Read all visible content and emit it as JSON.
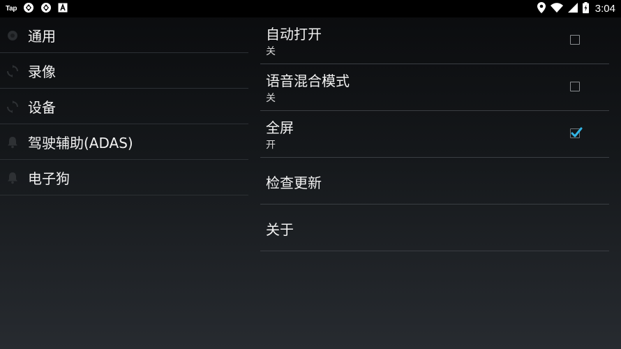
{
  "status_bar": {
    "left_icons": [
      "tap-label",
      "aperture-icon",
      "aperture-icon",
      "a-box-icon"
    ],
    "tap_text": "Tap",
    "right_icons": [
      "location-icon",
      "wifi-icon",
      "signal-icon",
      "battery-charging-icon"
    ],
    "time": "3:04"
  },
  "sidebar": {
    "items": [
      {
        "label": "通用",
        "icon": "settings-icon"
      },
      {
        "label": "录像",
        "icon": "sync-icon"
      },
      {
        "label": "设备",
        "icon": "sync-icon"
      },
      {
        "label": "驾驶辅助(ADAS)",
        "icon": "bell-icon"
      },
      {
        "label": "电子狗",
        "icon": "bell-icon"
      }
    ]
  },
  "preferences": [
    {
      "title": "自动打开",
      "summary": "关",
      "checkbox": true,
      "checked": false
    },
    {
      "title": "语音混合模式",
      "summary": "关",
      "checkbox": true,
      "checked": false
    },
    {
      "title": "全屏",
      "summary": "开",
      "checkbox": true,
      "checked": true
    },
    {
      "title": "检查更新"
    },
    {
      "title": "关于"
    }
  ],
  "colors": {
    "accent": "#33b5e5",
    "status_bar": "#000000",
    "divider": "#2c3034"
  }
}
